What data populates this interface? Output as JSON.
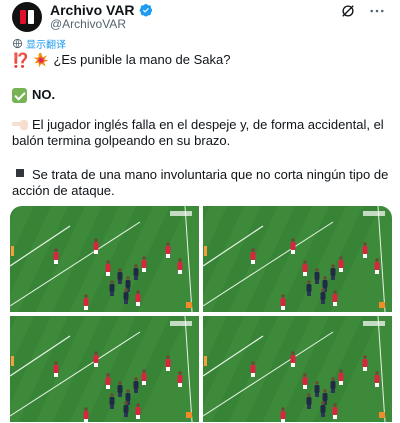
{
  "author": {
    "display_name": "Archivo VAR",
    "handle": "@ArchivoVAR",
    "verified": true
  },
  "translate_label": "显示翻译",
  "tweet": {
    "line1": "¿Es punible la mano de Saka?",
    "line1_prefix": "⁉️",
    "line2": "NO.",
    "line3": "El jugador inglés falla en el despeje y, de forma accidental, el balón termina golpeando en su brazo.",
    "line4": "Se trata de una mano involuntaria que no corta ningún tipo de acción de ataque."
  },
  "icons": {
    "avatar": "archivo-var-logo",
    "verified": "verified-badge-icon",
    "grok": "grok-icon",
    "more": "more-options-icon",
    "translate": "translate-icon",
    "burst": "collision-emoji",
    "check": "check-mark-button-emoji",
    "hand": "backhand-index-pointing-right-emoji",
    "bullet": "black-small-square-emoji"
  },
  "colors": {
    "accent": "#1d9bf0",
    "text": "#0f1419",
    "muted": "#536471",
    "pitch": "#3d8a3a",
    "team_red": "#d7263d",
    "team_dark": "#1f2a44"
  },
  "media": {
    "count": 4,
    "frames": [
      "frame-1",
      "frame-2",
      "frame-3",
      "frame-4"
    ]
  }
}
